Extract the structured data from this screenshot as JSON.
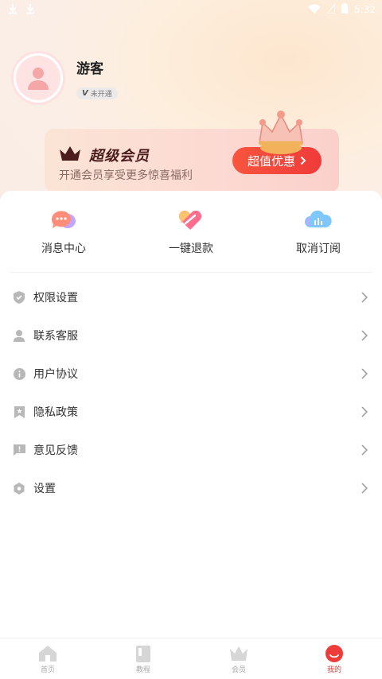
{
  "status_bar": {
    "time": "5:32"
  },
  "profile": {
    "name": "游客",
    "vip_badge_v": "V",
    "vip_badge": "未开通"
  },
  "vip_card": {
    "title": "超级会员",
    "subtitle": "开通会员享受更多惊喜福利",
    "button": "超值优惠"
  },
  "quick_actions": [
    {
      "label": "消息中心",
      "icon": "message-icon"
    },
    {
      "label": "一键退款",
      "icon": "refund-heart-icon"
    },
    {
      "label": "取消订阅",
      "icon": "cloud-icon"
    }
  ],
  "menu": [
    {
      "label": "权限设置",
      "icon": "shield-icon"
    },
    {
      "label": "联系客服",
      "icon": "user-icon"
    },
    {
      "label": "用户协议",
      "icon": "info-icon"
    },
    {
      "label": "隐私政策",
      "icon": "bookmark-icon"
    },
    {
      "label": "意见反馈",
      "icon": "feedback-icon"
    },
    {
      "label": "设置",
      "icon": "gear-icon"
    }
  ],
  "tabbar": [
    {
      "label": "首页",
      "icon": "home-icon",
      "active": false
    },
    {
      "label": "教程",
      "icon": "book-icon",
      "active": false
    },
    {
      "label": "会员",
      "icon": "crown-icon",
      "active": false
    },
    {
      "label": "我的",
      "icon": "profile-icon",
      "active": true
    }
  ],
  "colors": {
    "accent": "#ef3b3a",
    "vip_text": "#4a1c1c"
  }
}
